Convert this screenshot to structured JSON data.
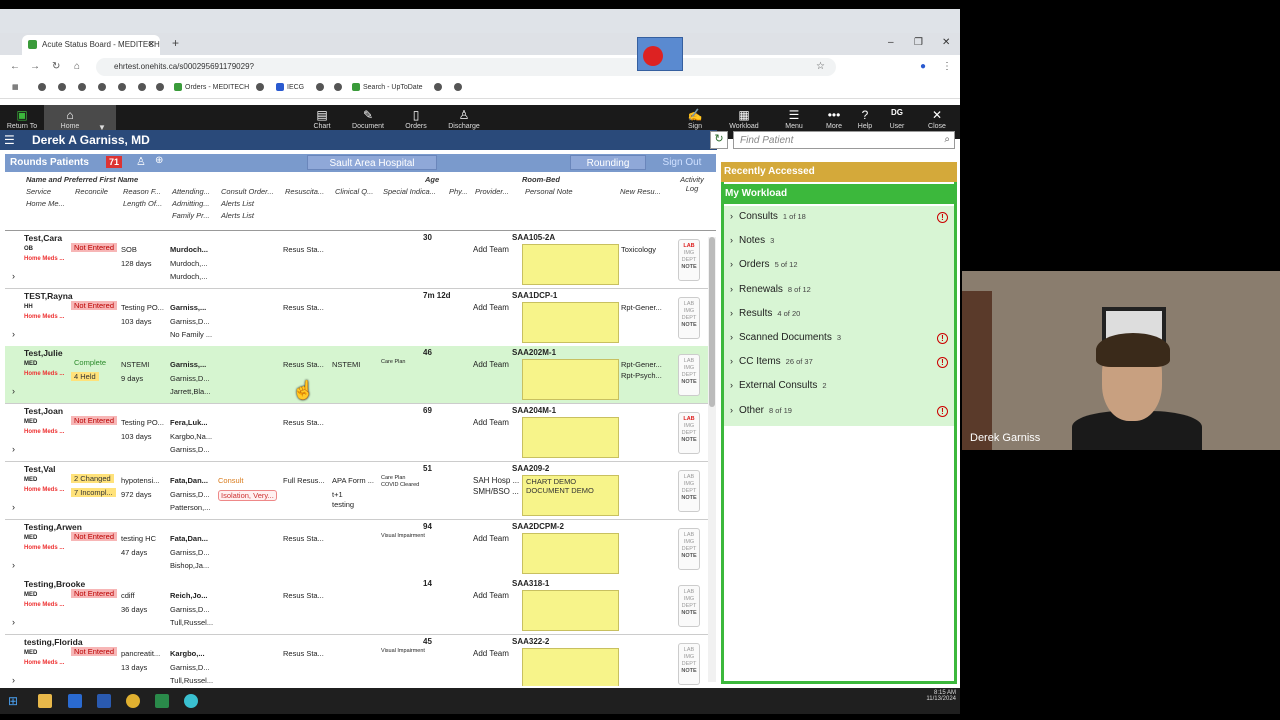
{
  "browser": {
    "tab_title": "Acute Status Board - MEDITECH",
    "url": "ehrtest.onehits.ca/s000295691179029?",
    "bookmarks": [
      "Orders - MEDITECH",
      "IECG",
      "Search - UpToDate"
    ]
  },
  "toolbar": {
    "return_label": "Return To",
    "home_label": "Home",
    "items": [
      "Chart",
      "Document",
      "Orders",
      "Discharge"
    ],
    "right_items": [
      "Sign",
      "Workload",
      "Menu",
      "More",
      "Help",
      "User",
      "Close"
    ],
    "user_initials": "DG"
  },
  "header": {
    "doctor": "Derek A Garniss, MD",
    "find_placeholder": "Find Patient"
  },
  "rounds": {
    "title": "Rounds Patients",
    "count": "71",
    "hospital": "Sault Area Hospital",
    "rounding": "Rounding",
    "signout": "Sign Out"
  },
  "columns": {
    "name": "Name and Preferred First Name",
    "service": "Service",
    "reconcile": "Reconcile",
    "reason": "Reason F...",
    "attending": "Attending...",
    "consult": "Consult Order...",
    "resus": "Resuscita...",
    "clinical": "Clinical Q...",
    "special": "Special Indica...",
    "phy": "Phy...",
    "provider": "Provider...",
    "age": "Age",
    "roombed": "Room-Bed",
    "personal": "Personal Note",
    "newres": "New Resu...",
    "activity": "Activity Log",
    "home_meds": "Home Me...",
    "length": "Length Of...",
    "admitting": "Admitting...",
    "alerts1": "Alerts List",
    "family": "Family Pr...",
    "alerts2": "Alerts List"
  },
  "patients": [
    {
      "name": "Test,Cara",
      "svc": "OB",
      "status": "Not Entered",
      "reason": "SOB",
      "los": "128 days",
      "att": "Murdoch...",
      "adm": "Murdoch,...",
      "fam": "Murdoch,...",
      "resus": "Resus Sta...",
      "age": "30",
      "provider": "Add Team",
      "bed": "SAA105-2A",
      "note": "",
      "newres": "Toxicology",
      "lab_red": true
    },
    {
      "name": "TEST,Rayna",
      "svc": "HH",
      "status": "Not Entered",
      "reason": "Testing PO...",
      "los": "103 days",
      "att": "Garniss,...",
      "adm": "Garniss,D...",
      "fam": "No Family ...",
      "resus": "Resus Sta...",
      "age": "7m 12d",
      "provider": "Add Team",
      "bed": "SAA1DCP-1",
      "note": "",
      "newres": "Rpt-Gener...",
      "lab_red": false
    },
    {
      "name": "Test,Julie",
      "svc": "MED",
      "status": "Complete",
      "status2": "4 Held",
      "reason": "NSTEMI",
      "los": "9 days",
      "att": "Garniss,...",
      "adm": "Garniss,D...",
      "fam": "Jarrett,Bla...",
      "resus": "Resus Sta...",
      "clin": "NSTEMI",
      "special": "Care Plan",
      "age": "46",
      "provider": "Add Team",
      "bed": "SAA202M-1",
      "note": "",
      "newres": "Rpt-Gener...",
      "newres2": "Rpt-Psych...",
      "lab_red": false
    },
    {
      "name": "Test,Joan",
      "svc": "MED",
      "status": "Not Entered",
      "reason": "Testing PO...",
      "los": "103 days",
      "att": "Fera,Luk...",
      "adm": "Kargbo,Na...",
      "fam": "Garniss,D...",
      "resus": "Resus Sta...",
      "age": "69",
      "provider": "Add Team",
      "bed": "SAA204M-1",
      "note": "",
      "newres": "",
      "lab_red": true
    },
    {
      "name": "Test,Val",
      "svc": "MED",
      "status": "2 Changed",
      "status2": "7 Incompl...",
      "reason": "hypotensi...",
      "los": "972 days",
      "att": "Fata,Dan...",
      "adm": "Garniss,D...",
      "fam": "Patterson,...",
      "consult": "Consult",
      "alert": "Isolation, Very...",
      "resus": "Full Resus...",
      "clin": "APA Form ...",
      "clin2": "t+1",
      "clin3": "testing",
      "special": "Care Plan",
      "special2": "COVID Cleared",
      "age": "51",
      "provider": "SAH Hosp ...",
      "provider2": "SMH/BSO ...",
      "bed": "SAA209-2",
      "note": "CHART DEMO DOCUMENT DEMO",
      "newres": "",
      "lab_red": false
    },
    {
      "name": "Testing,Arwen",
      "svc": "MED",
      "status": "Not Entered",
      "reason": "testing HC",
      "los": "47 days",
      "att": "Fata,Dan...",
      "adm": "Garniss,D...",
      "fam": "Bishop,Ja...",
      "resus": "Resus Sta...",
      "special": "Visual Impairment",
      "age": "94",
      "provider": "Add Team",
      "bed": "SAA2DCPM-2",
      "note": "",
      "newres": "",
      "lab_red": false
    },
    {
      "name": "Testing,Brooke",
      "svc": "MED",
      "status": "Not Entered",
      "reason": "cdiff",
      "los": "36 days",
      "att": "Reich,Jo...",
      "adm": "Garniss,D...",
      "fam": "Tull,Russel...",
      "resus": "Resus Sta...",
      "age": "14",
      "provider": "Add Team",
      "bed": "SAA318-1",
      "note": "",
      "newres": "",
      "lab_red": false
    },
    {
      "name": "testing,Florida",
      "svc": "MED",
      "status": "Not Entered",
      "reason": "pancreatit...",
      "los": "13 days",
      "att": "Kargbo,...",
      "adm": "Garniss,D...",
      "fam": "Tull,Russel...",
      "resus": "Resus Sta...",
      "special": "Visual Impairment",
      "age": "45",
      "provider": "Add Team",
      "bed": "SAA322-2",
      "note": "",
      "newres": "",
      "lab_red": false
    }
  ],
  "home_meds_label": "Home Meds ...",
  "lab_text": [
    "LAB",
    "IMG",
    "DEPT",
    "NOTE"
  ],
  "sidebar": {
    "recent": "Recently Accessed",
    "workload": "My Workload",
    "items": [
      {
        "label": "Consults",
        "count": "1 of 18",
        "alert": true
      },
      {
        "label": "Notes",
        "count": "3",
        "alert": false
      },
      {
        "label": "Orders",
        "count": "5 of 12",
        "alert": false
      },
      {
        "label": "Renewals",
        "count": "8 of 12",
        "alert": false
      },
      {
        "label": "Results",
        "count": "4 of 20",
        "alert": false
      },
      {
        "label": "Scanned Documents",
        "count": "3",
        "alert": true
      },
      {
        "label": "CC Items",
        "count": "26 of 37",
        "alert": true
      },
      {
        "label": "External Consults",
        "count": "2",
        "alert": false
      },
      {
        "label": "Other",
        "count": "8 of 19",
        "alert": true
      }
    ]
  },
  "webcam": {
    "name": "Derek Garniss"
  },
  "taskbar": {
    "time": "8:15 AM",
    "date": "11/13/2024"
  }
}
